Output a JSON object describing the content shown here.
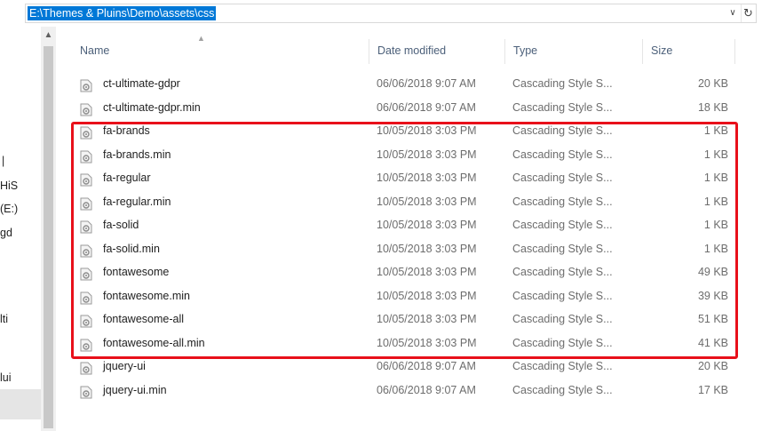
{
  "address_bar": {
    "path": "E:\\Themes & Pluins\\Demo\\assets\\css",
    "dropdown_icon": "chevron-down-icon",
    "refresh_icon": "refresh-icon"
  },
  "nav_pane": {
    "partial_labels": [
      "HiS",
      "(E:)",
      "gd",
      "lti",
      "lui"
    ]
  },
  "columns": {
    "name": "Name",
    "date": "Date modified",
    "type": "Type",
    "size": "Size"
  },
  "files": [
    {
      "name": "ct-ultimate-gdpr",
      "date": "06/06/2018 9:07 AM",
      "type": "Cascading Style S...",
      "size": "20 KB"
    },
    {
      "name": "ct-ultimate-gdpr.min",
      "date": "06/06/2018 9:07 AM",
      "type": "Cascading Style S...",
      "size": "18 KB"
    },
    {
      "name": "fa-brands",
      "date": "10/05/2018 3:03 PM",
      "type": "Cascading Style S...",
      "size": "1 KB"
    },
    {
      "name": "fa-brands.min",
      "date": "10/05/2018 3:03 PM",
      "type": "Cascading Style S...",
      "size": "1 KB"
    },
    {
      "name": "fa-regular",
      "date": "10/05/2018 3:03 PM",
      "type": "Cascading Style S...",
      "size": "1 KB"
    },
    {
      "name": "fa-regular.min",
      "date": "10/05/2018 3:03 PM",
      "type": "Cascading Style S...",
      "size": "1 KB"
    },
    {
      "name": "fa-solid",
      "date": "10/05/2018 3:03 PM",
      "type": "Cascading Style S...",
      "size": "1 KB"
    },
    {
      "name": "fa-solid.min",
      "date": "10/05/2018 3:03 PM",
      "type": "Cascading Style S...",
      "size": "1 KB"
    },
    {
      "name": "fontawesome",
      "date": "10/05/2018 3:03 PM",
      "type": "Cascading Style S...",
      "size": "49 KB"
    },
    {
      "name": "fontawesome.min",
      "date": "10/05/2018 3:03 PM",
      "type": "Cascading Style S...",
      "size": "39 KB"
    },
    {
      "name": "fontawesome-all",
      "date": "10/05/2018 3:03 PM",
      "type": "Cascading Style S...",
      "size": "51 KB"
    },
    {
      "name": "fontawesome-all.min",
      "date": "10/05/2018 3:03 PM",
      "type": "Cascading Style S...",
      "size": "41 KB"
    },
    {
      "name": "jquery-ui",
      "date": "06/06/2018 9:07 AM",
      "type": "Cascading Style S...",
      "size": "20 KB"
    },
    {
      "name": "jquery-ui.min",
      "date": "06/06/2018 9:07 AM",
      "type": "Cascading Style S...",
      "size": "17 KB"
    }
  ],
  "file_icon": "css-file-icon",
  "colors": {
    "selection": "#0078d7",
    "highlight_border": "#e8101a",
    "header_text": "#4c607a"
  }
}
